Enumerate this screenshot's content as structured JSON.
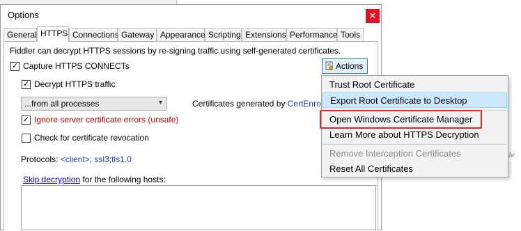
{
  "dialog": {
    "title": "Options",
    "close_glyph": "✕"
  },
  "tabs": [
    "General",
    "HTTPS",
    "Connections",
    "Gateway",
    "Appearance",
    "Scripting",
    "Extensions",
    "Performance",
    "Tools"
  ],
  "active_tab": "HTTPS",
  "https": {
    "intro": "Fiddler can decrypt HTTPS sessions by re-signing traffic using self-generated certificates.",
    "capture_label": "Capture HTTPS CONNECTs",
    "capture_checked": true,
    "decrypt_label": "Decrypt HTTPS traffic",
    "decrypt_checked": true,
    "process_filter": "...from all processes",
    "ignore_errors_label": "Ignore server certificate errors (unsafe)",
    "ignore_errors_checked": true,
    "revocation_label": "Check for certificate revocation",
    "revocation_checked": false,
    "certs_generated_prefix": "Certificates generated by ",
    "certs_generated_engine": "CertEnroll e",
    "protocols_label": "Protocols: ",
    "protocols_value": "<client>; ssl3;tls1.0",
    "skip_link": "Skip decryption",
    "skip_suffix": " for the following hosts:",
    "actions_label": "Actions"
  },
  "menu": {
    "items": [
      {
        "label": "Trust Root Certificate",
        "state": "normal"
      },
      {
        "label": "Export Root Certificate to Desktop",
        "state": "highlighted"
      },
      {
        "label": "Open Windows Certificate Manager",
        "state": "normal",
        "annotated": true
      },
      {
        "label": "Learn More about HTTPS Decryption",
        "state": "normal"
      },
      {
        "label": "Remove Interception Certificates",
        "state": "disabled"
      },
      {
        "label": "Reset All Certificates",
        "state": "normal"
      }
    ]
  },
  "colors": {
    "highlight": "#cce8ff",
    "annotation": "#e8262a",
    "close": "#e81123",
    "warning_text": "#c00000"
  }
}
